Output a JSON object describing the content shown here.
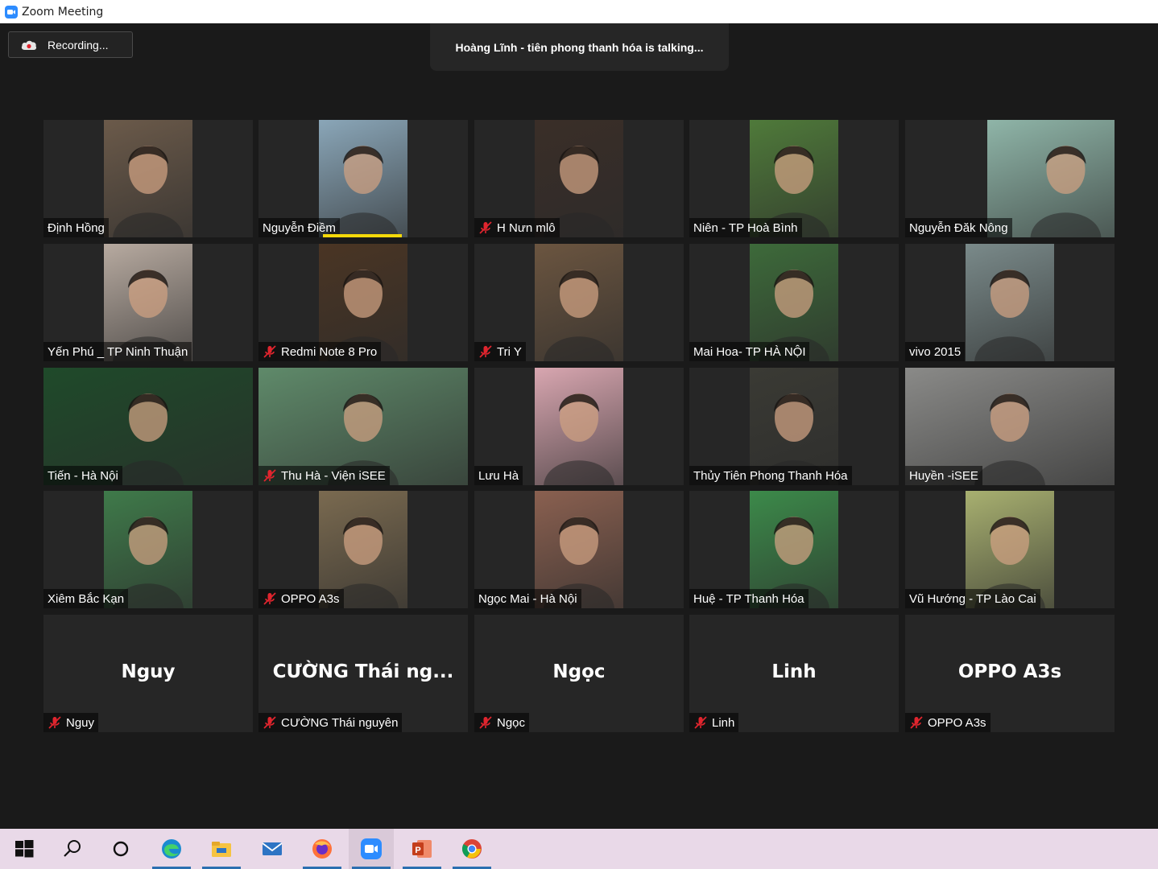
{
  "window": {
    "title": "Zoom Meeting"
  },
  "recording": {
    "label": "Recording..."
  },
  "talking_banner": {
    "text": "Hoàng Lĩnh - tiên phong thanh hóa is talking..."
  },
  "participants": [
    {
      "name": "Định Hồng",
      "muted": false,
      "video": true,
      "tone": "#6b5a4a"
    },
    {
      "name": "Nguyễn Điềm",
      "muted": false,
      "video": true,
      "tone": "#8aa6b8",
      "speaking": true
    },
    {
      "name": "H Nưn mlô",
      "muted": true,
      "video": true,
      "tone": "#3a2e28"
    },
    {
      "name": "Niên - TP Hoà Bình",
      "muted": false,
      "video": true,
      "tone": "#4f7a3a"
    },
    {
      "name": "Nguyễn Đăk Nông",
      "muted": false,
      "video": true,
      "tone": "#8fb5a8"
    },
    {
      "name": "Yến Phú _ TP Ninh Thuận",
      "muted": false,
      "video": true,
      "tone": "#b7aaa0"
    },
    {
      "name": "Redmi Note 8 Pro",
      "muted": true,
      "video": true,
      "tone": "#4a3524"
    },
    {
      "name": "Tri Y",
      "muted": true,
      "video": true,
      "tone": "#6b5540"
    },
    {
      "name": "Mai Hoa- TP HÀ NỘI",
      "muted": false,
      "video": true,
      "tone": "#3d6a3a"
    },
    {
      "name": "vivo 2015",
      "muted": false,
      "video": true,
      "tone": "#7a8a8a"
    },
    {
      "name": "Tiến - Hà Nội",
      "muted": false,
      "video": true,
      "tone": "#1f4a2a"
    },
    {
      "name": "Thu Hà - Viện iSEE",
      "muted": true,
      "video": true,
      "tone": "#5f8a6a"
    },
    {
      "name": "Lưu Hà",
      "muted": false,
      "video": true,
      "tone": "#d8a6b0"
    },
    {
      "name": "Thủy Tiên Phong Thanh Hóa",
      "muted": false,
      "video": true,
      "tone": "#3a3a34"
    },
    {
      "name": "Huyền -iSEE",
      "muted": false,
      "video": true,
      "tone": "#8a8a88"
    },
    {
      "name": "Xiêm Bắc Kạn",
      "muted": false,
      "video": true,
      "tone": "#3f7a4a"
    },
    {
      "name": "OPPO A3s",
      "muted": true,
      "video": true,
      "tone": "#7a6a50"
    },
    {
      "name": "Ngọc Mai - Hà Nội",
      "muted": false,
      "video": true,
      "tone": "#8a6050"
    },
    {
      "name": "Huệ - TP Thanh Hóa",
      "muted": false,
      "video": true,
      "tone": "#3c8a4a"
    },
    {
      "name": "Vũ Hướng - TP Lào Cai",
      "muted": false,
      "video": true,
      "tone": "#a8b070"
    },
    {
      "name": "Nguy",
      "muted": true,
      "video": false,
      "big": "Nguy"
    },
    {
      "name": "CƯỜNG Thái nguyên",
      "muted": true,
      "video": false,
      "big": "CƯỜNG Thái ng..."
    },
    {
      "name": "Ngọc",
      "muted": true,
      "video": false,
      "big": "Ngọc"
    },
    {
      "name": "Linh",
      "muted": true,
      "video": false,
      "big": "Linh"
    },
    {
      "name": "OPPO A3s",
      "muted": true,
      "video": false,
      "big": "OPPO A3s"
    }
  ],
  "taskbar": {
    "items": [
      {
        "icon": "windows-start-icon"
      },
      {
        "icon": "search-icon"
      },
      {
        "icon": "cortana-icon"
      },
      {
        "icon": "edge-icon",
        "running": true
      },
      {
        "icon": "file-explorer-icon",
        "running": true
      },
      {
        "icon": "mail-icon"
      },
      {
        "icon": "firefox-icon",
        "running": true
      },
      {
        "icon": "zoom-icon",
        "running": true,
        "active": true
      },
      {
        "icon": "powerpoint-icon",
        "running": true
      },
      {
        "icon": "chrome-icon",
        "running": true
      }
    ]
  }
}
